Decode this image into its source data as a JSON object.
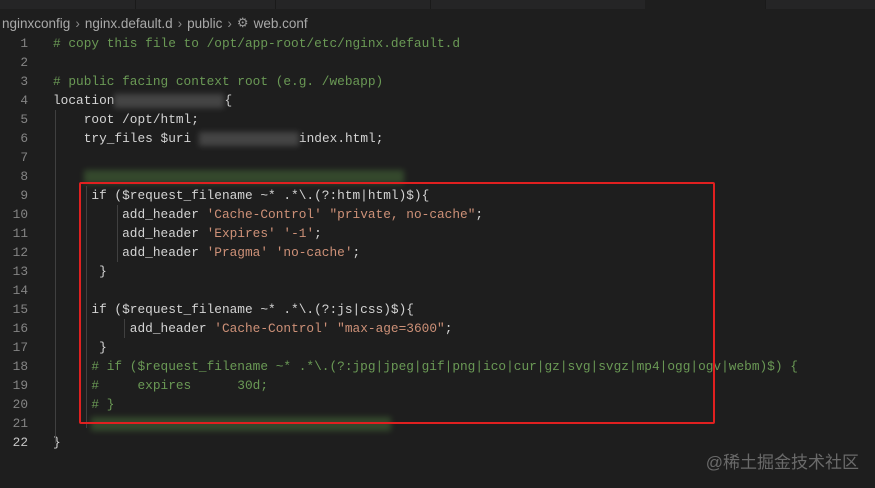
{
  "breadcrumb": [
    "nginxconfig",
    "nginx.default.d",
    "public",
    "web.conf"
  ],
  "breadcrumb_icon": "gear-icon",
  "lines": [
    {
      "n": "1",
      "seg": [
        [
          "# copy this file to /opt/app-root/etc/nginx.default.d",
          "cm"
        ]
      ]
    },
    {
      "n": "2",
      "seg": []
    },
    {
      "n": "3",
      "seg": [
        [
          "# public facing context root (e.g. /webapp)",
          "cm"
        ]
      ]
    },
    {
      "n": "4",
      "seg": [
        [
          "location",
          ""
        ],
        [
          "~blur:110",
          ""
        ],
        [
          "{",
          ""
        ]
      ]
    },
    {
      "n": "5",
      "seg": [
        [
          "    root /opt/html;",
          ""
        ]
      ]
    },
    {
      "n": "6",
      "seg": [
        [
          "    try_files $uri ",
          ""
        ],
        [
          "~blur:100",
          ""
        ],
        [
          "index.html;",
          ""
        ]
      ]
    },
    {
      "n": "7",
      "seg": []
    },
    {
      "n": "8",
      "seg": [
        [
          "    ",
          ""
        ],
        [
          "~blurg:320",
          ""
        ]
      ]
    },
    {
      "n": "9",
      "seg": [
        [
          "     if ($request_filename ~* .*\\.(?:htm|html)$){",
          ""
        ]
      ]
    },
    {
      "n": "10",
      "seg": [
        [
          "         add_header ",
          ""
        ],
        [
          "'Cache-Control'",
          "str"
        ],
        [
          " ",
          ""
        ],
        [
          "\"private, no-cache\"",
          "str"
        ],
        [
          ";",
          ""
        ]
      ]
    },
    {
      "n": "11",
      "seg": [
        [
          "         add_header ",
          ""
        ],
        [
          "'Expires'",
          "str"
        ],
        [
          " ",
          ""
        ],
        [
          "'-1'",
          "str"
        ],
        [
          ";",
          ""
        ]
      ]
    },
    {
      "n": "12",
      "seg": [
        [
          "         add_header ",
          ""
        ],
        [
          "'Pragma'",
          "str"
        ],
        [
          " ",
          ""
        ],
        [
          "'no-cache'",
          "str"
        ],
        [
          ";",
          ""
        ]
      ]
    },
    {
      "n": "13",
      "seg": [
        [
          "      }",
          ""
        ]
      ]
    },
    {
      "n": "14",
      "seg": []
    },
    {
      "n": "15",
      "seg": [
        [
          "     if ($request_filename ~* .*\\.(?:js|css)$){",
          ""
        ]
      ]
    },
    {
      "n": "16",
      "seg": [
        [
          "          add_header ",
          ""
        ],
        [
          "'Cache-Control'",
          "str"
        ],
        [
          " ",
          ""
        ],
        [
          "\"max-age=3600\"",
          "str"
        ],
        [
          ";",
          ""
        ]
      ]
    },
    {
      "n": "17",
      "seg": [
        [
          "      }",
          ""
        ]
      ]
    },
    {
      "n": "18",
      "seg": [
        [
          "     # if ($request_filename ~* .*\\.(?:jpg|jpeg|gif|png|ico|cur|gz|svg|svgz|mp4|ogg|ogv|webm)$) {",
          "cm"
        ]
      ]
    },
    {
      "n": "19",
      "seg": [
        [
          "     #     expires      30d;",
          "cm"
        ]
      ]
    },
    {
      "n": "20",
      "seg": [
        [
          "     # }",
          "cm"
        ]
      ]
    },
    {
      "n": "21",
      "seg": [
        [
          "     ",
          ""
        ],
        [
          "~blurg:300",
          ""
        ]
      ]
    },
    {
      "n": "22",
      "seg": [
        [
          "}",
          ""
        ]
      ]
    }
  ],
  "watermark": "@稀土掘金技术社区"
}
